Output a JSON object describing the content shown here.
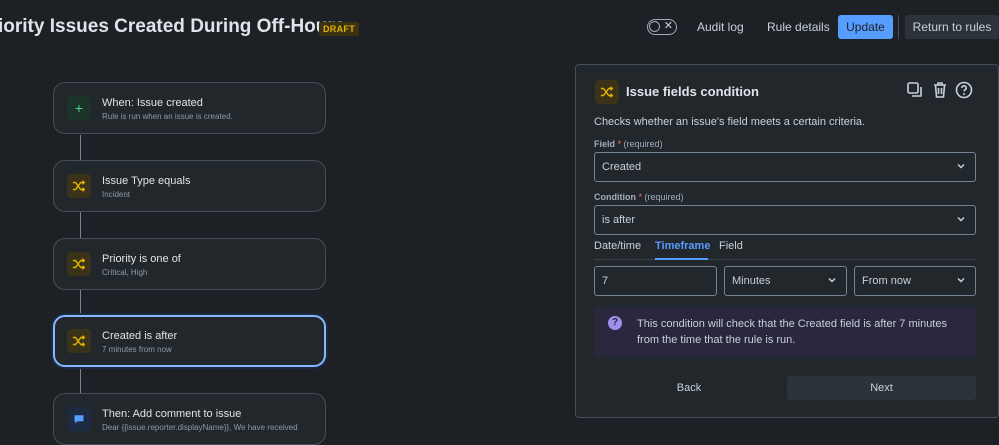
{
  "header": {
    "title": "iority Issues Created During Off-Hours",
    "badge": "DRAFT",
    "audit_log": "Audit log",
    "rule_details": "Rule details",
    "update": "Update",
    "return": "Return to rules"
  },
  "flow": {
    "items": [
      {
        "title": "When: Issue created",
        "subtitle": "Rule is run when an issue is created.",
        "icon": "plus-icon"
      },
      {
        "title": "Issue Type equals",
        "subtitle": "Incident",
        "icon": "shuffle-icon"
      },
      {
        "title": "Priority is one of",
        "subtitle": "Critical, High",
        "icon": "shuffle-icon"
      },
      {
        "title": "Created is after",
        "subtitle": "7 minutes from now",
        "icon": "shuffle-icon"
      },
      {
        "title": "Then: Add comment to issue",
        "subtitle": "Dear {{issue.reporter.displayName}}, We have received",
        "icon": "comment-icon"
      }
    ]
  },
  "panel": {
    "title": "Issue fields condition",
    "description": "Checks whether an issue's field meets a certain criteria.",
    "field_label": "Field",
    "field_req": "(required)",
    "field_value": "Created",
    "condition_label": "Condition",
    "condition_req": "(required)",
    "condition_value": "is after",
    "tabs": [
      "Date/time",
      "Timeframe",
      "Field"
    ],
    "amount": "7",
    "unit": "Minutes",
    "direction": "From now",
    "info": "This condition will check that the Created field is after 7 minutes from the time that the rule is run.",
    "back": "Back",
    "next": "Next"
  },
  "colors": {
    "accent": "#579dff",
    "condition": "#e2b203",
    "trigger": "#4bce97",
    "background": "#1d2125"
  }
}
